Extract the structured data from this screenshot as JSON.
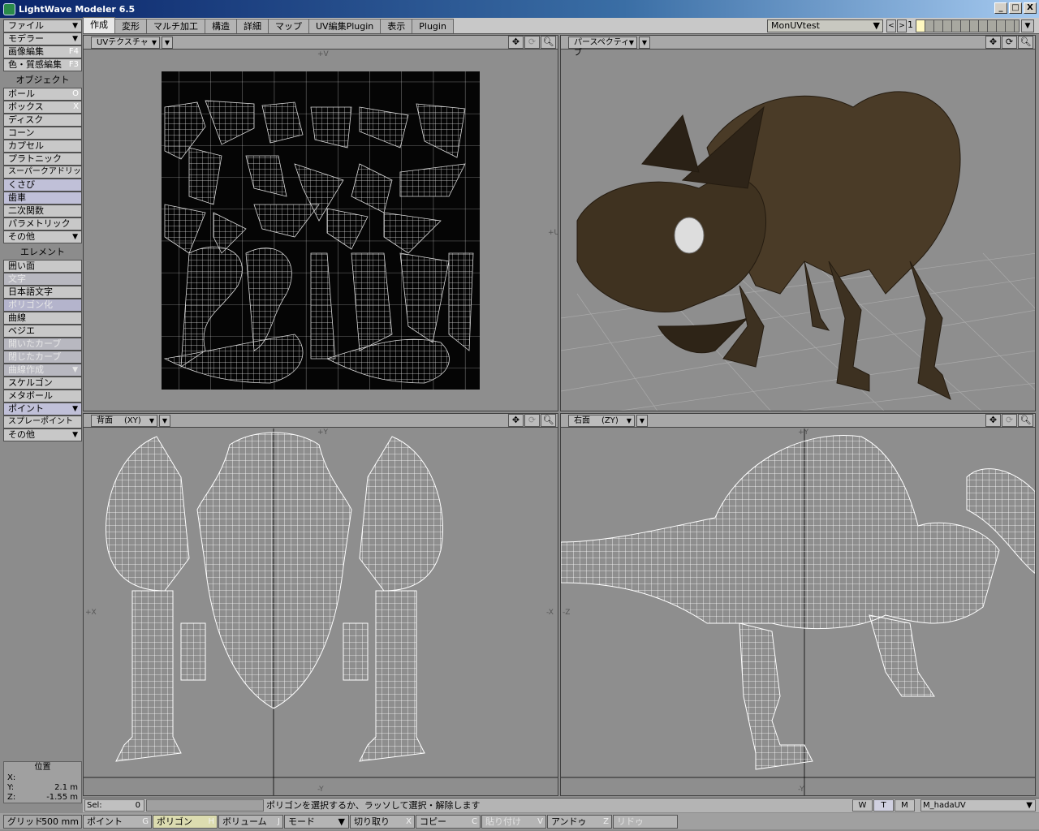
{
  "window": {
    "title": "LightWave Modeler 6.5",
    "buttons": [
      "_",
      "□",
      "X"
    ]
  },
  "tabs": [
    "作成",
    "変形",
    "マルチ加工",
    "構造",
    "詳細",
    "マップ",
    "UV編集Plugin",
    "表示",
    "Plugin"
  ],
  "top_right": {
    "uv_map": "MonUVtest",
    "prev": "<",
    "next": ">",
    "layer_number": "1",
    "layer_dd": "▼"
  },
  "sidebar": {
    "menu1": {
      "label": "ファイル"
    },
    "menu2": {
      "label": "モデラー"
    },
    "image_edit": {
      "label": "画像編集",
      "key": "F4"
    },
    "surface_edit": {
      "label": "色・質感編集",
      "key": "F3"
    },
    "objects_header": "オブジェクト",
    "objects": [
      {
        "label": "ボール",
        "key": "O"
      },
      {
        "label": "ボックス",
        "key": "X"
      },
      {
        "label": "ディスク",
        "key": ""
      },
      {
        "label": "コーン",
        "key": ""
      },
      {
        "label": "カプセル",
        "key": ""
      },
      {
        "label": "プラトニック",
        "key": ""
      },
      {
        "label": "スーパークアドリック",
        "key": ""
      },
      {
        "label": "くさび",
        "key": ""
      },
      {
        "label": "歯車",
        "key": ""
      },
      {
        "label": "二次関数",
        "key": ""
      },
      {
        "label": "パラメトリック",
        "key": ""
      },
      {
        "label": "その他",
        "key": "▼"
      }
    ],
    "elements_header": "エレメント",
    "elements": [
      {
        "label": "囲い面",
        "key": ""
      },
      {
        "label": "文字",
        "key": ""
      },
      {
        "label": "日本語文字",
        "key": ""
      },
      {
        "label": "ポリゴン化",
        "key": ""
      },
      {
        "label": "曲線",
        "key": ""
      },
      {
        "label": "ベジエ",
        "key": ""
      },
      {
        "label": "開いたカーブ",
        "key": ""
      },
      {
        "label": "閉じたカーブ",
        "key": ""
      },
      {
        "label": "曲線作成",
        "key": "▼"
      },
      {
        "label": "スケルゴン",
        "key": ""
      },
      {
        "label": "メタボール",
        "key": ""
      },
      {
        "label": "ポイント",
        "key": "▼"
      },
      {
        "label": "スプレーポイント",
        "key": ""
      },
      {
        "label": "その他",
        "key": "▼"
      }
    ]
  },
  "position": {
    "title": "位置",
    "x_label": "X:",
    "x_value": "",
    "y_label": "Y:",
    "y_value": "2.1 m",
    "z_label": "Z:",
    "z_value": "-1.55 m"
  },
  "viewports": {
    "uv": {
      "label": "UVテクスチャ",
      "axis_top": "+V",
      "axis_right": "+U"
    },
    "persp": {
      "label": "パースペクティブ"
    },
    "back": {
      "label": "背面",
      "axes": "(XY)",
      "axis_top": "+Y",
      "axis_bottom": "-Y",
      "axis_left": "+X",
      "axis_right": "-X"
    },
    "right": {
      "label": "右面",
      "axes": "(ZY)",
      "axis_top": "+Y",
      "axis_bottom": "-Y",
      "axis_left": "-Z"
    }
  },
  "status": {
    "sel_label": "Sel:",
    "sel_value": "0",
    "message": "ポリゴンを選択するか、ラッソして選択・解除します",
    "w": "W",
    "t": "T",
    "m": "M",
    "surface": "M_hadaUV"
  },
  "bottom": {
    "grid_label": "グリッド:",
    "grid_value": "500 mm",
    "point": {
      "label": "ポイント",
      "key": "G"
    },
    "polygon": {
      "label": "ポリゴン",
      "key": "H"
    },
    "volume": {
      "label": "ボリューム",
      "key": "J"
    },
    "mode": {
      "label": "モード"
    },
    "cut": {
      "label": "切り取り",
      "key": "X"
    },
    "copy": {
      "label": "コピー",
      "key": "C"
    },
    "paste": {
      "label": "貼り付け",
      "key": "V"
    },
    "undo": {
      "label": "アンドゥ",
      "key": "Z"
    },
    "redo": {
      "label": "リドゥ",
      "key": ""
    }
  }
}
